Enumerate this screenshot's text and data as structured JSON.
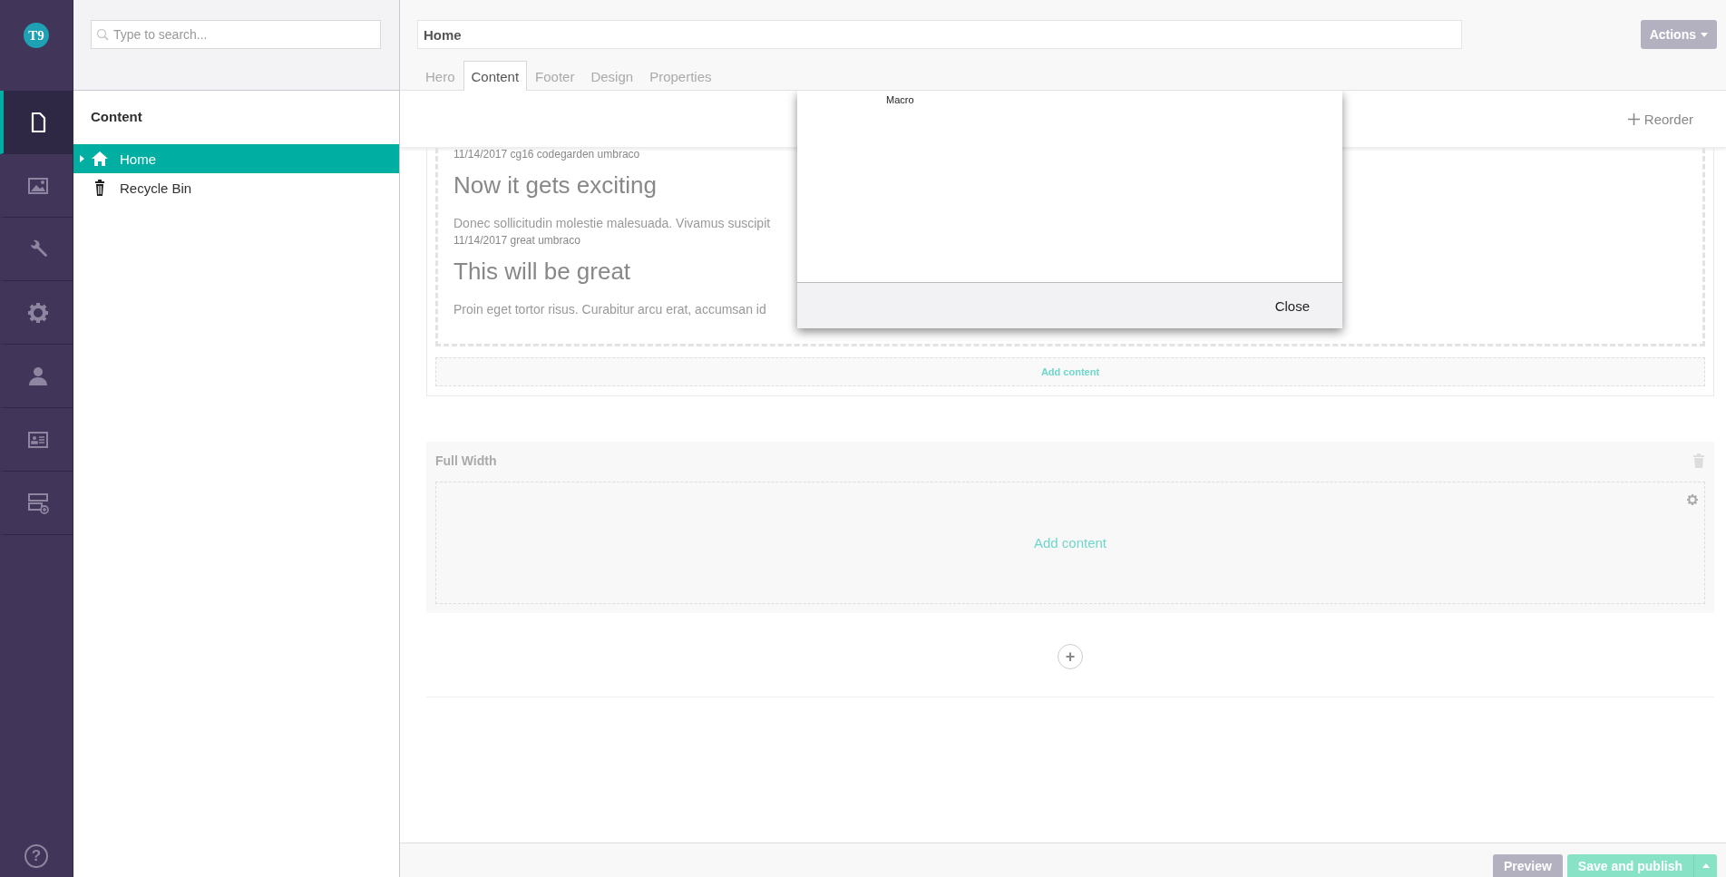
{
  "nav": {
    "logo": "T9",
    "sections": [
      {
        "kind": "document",
        "selected": true
      },
      {
        "kind": "image",
        "selected": false
      },
      {
        "kind": "wrench",
        "selected": false
      },
      {
        "kind": "gear",
        "selected": false
      },
      {
        "kind": "person",
        "selected": false
      },
      {
        "kind": "card",
        "selected": false
      },
      {
        "kind": "layout",
        "selected": false
      }
    ],
    "help": "?"
  },
  "tree": {
    "search_placeholder": "Type to search...",
    "heading": "Content",
    "items": [
      {
        "kind": "home",
        "label": "Home",
        "selected": true,
        "expanded": false
      },
      {
        "kind": "bin",
        "label": "Recycle Bin",
        "selected": false
      }
    ]
  },
  "editor": {
    "name": "Home",
    "actions": "Actions",
    "tabs": [
      {
        "label": "Hero",
        "selected": false
      },
      {
        "label": "Content",
        "selected": true
      },
      {
        "label": "Footer",
        "selected": false
      },
      {
        "label": "Design",
        "selected": false
      },
      {
        "label": "Properties",
        "selected": false
      }
    ],
    "reorder": "Reorder",
    "grid_content": [
      {
        "kind": "date",
        "text": "11/14/2017 cg16 codegarden umbraco"
      },
      {
        "kind": "heading",
        "text": "Now it gets exciting"
      },
      {
        "kind": "paragraph",
        "text": "Donec sollicitudin molestie malesuada. Vivamus suscipit"
      },
      {
        "kind": "date",
        "text": "11/14/2017 great umbraco"
      },
      {
        "kind": "heading",
        "text": "This will be great"
      },
      {
        "kind": "paragraph",
        "text": "Proin eget tortor risus. Curabitur arcu erat, accumsan id"
      }
    ],
    "add_content": "Add content",
    "full_width": {
      "title": "Full Width",
      "add_content": "Add content"
    },
    "add_row": "+",
    "dialog": {
      "text": "Macro",
      "close": "Close"
    },
    "preview": "Preview",
    "save": "Save and publish"
  }
}
